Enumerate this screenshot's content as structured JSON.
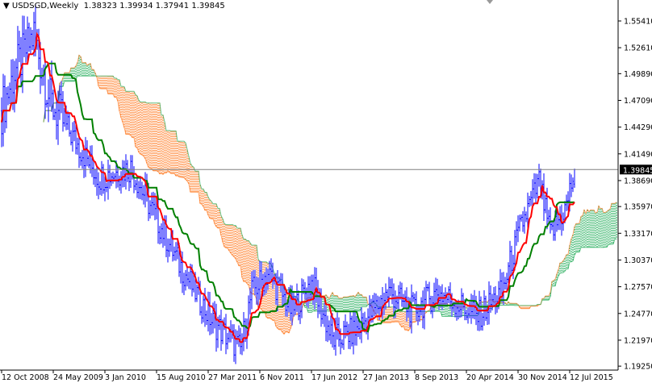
{
  "header": {
    "symbol": "USDSGD,Weekly",
    "open": "1.38323",
    "high": "1.39934",
    "low": "1.37941",
    "close": "1.39845"
  },
  "chart_data": {
    "type": "ohlc-bar+ichimoku",
    "symbol": "USDSGD",
    "timeframe": "Weekly",
    "colors": {
      "bars": "#0000ff",
      "tenkan": "#ff0000",
      "kijun": "#008000",
      "cloud_up": "#00a040",
      "cloud_down": "#ff6600",
      "price_line": "#808080"
    },
    "current_price": "1.39845",
    "y_ticks": [
      "1.55410",
      "1.52610",
      "1.49890",
      "1.47090",
      "1.44290",
      "1.41490",
      "1.38690",
      "1.35970",
      "1.33170",
      "1.30370",
      "1.27570",
      "1.24770",
      "1.21970",
      "1.19250"
    ],
    "x_ticks": [
      "12 Oct 2008",
      "24 May 2009",
      "3 Jan 2010",
      "15 Aug 2010",
      "27 Mar 2011",
      "6 Nov 2011",
      "17 Jun 2012",
      "27 Jan 2013",
      "8 Sep 2013",
      "20 Apr 2014",
      "30 Nov 2014",
      "12 Jul 2015"
    ],
    "x_tick_week_index": [
      0,
      32,
      64,
      96,
      128,
      160,
      192,
      224,
      256,
      288,
      320,
      352
    ],
    "ylim": [
      1.1925,
      1.5541
    ],
    "close_path_weeks": [
      0,
      8,
      20,
      30,
      45,
      60,
      80,
      95,
      110,
      130,
      148,
      155,
      165,
      180,
      192,
      205,
      220,
      240,
      255,
      270,
      295,
      310,
      322,
      333,
      340,
      350,
      355
    ],
    "close_path_values": [
      1.46,
      1.5,
      1.54,
      1.47,
      1.43,
      1.39,
      1.4,
      1.35,
      1.3,
      1.24,
      1.21,
      1.27,
      1.29,
      1.25,
      1.28,
      1.22,
      1.23,
      1.27,
      1.25,
      1.27,
      1.245,
      1.27,
      1.34,
      1.385,
      1.33,
      1.36,
      1.398
    ],
    "ichimoku": {
      "tenkan": 9,
      "kijun": 26,
      "senkou_b": 52
    }
  }
}
